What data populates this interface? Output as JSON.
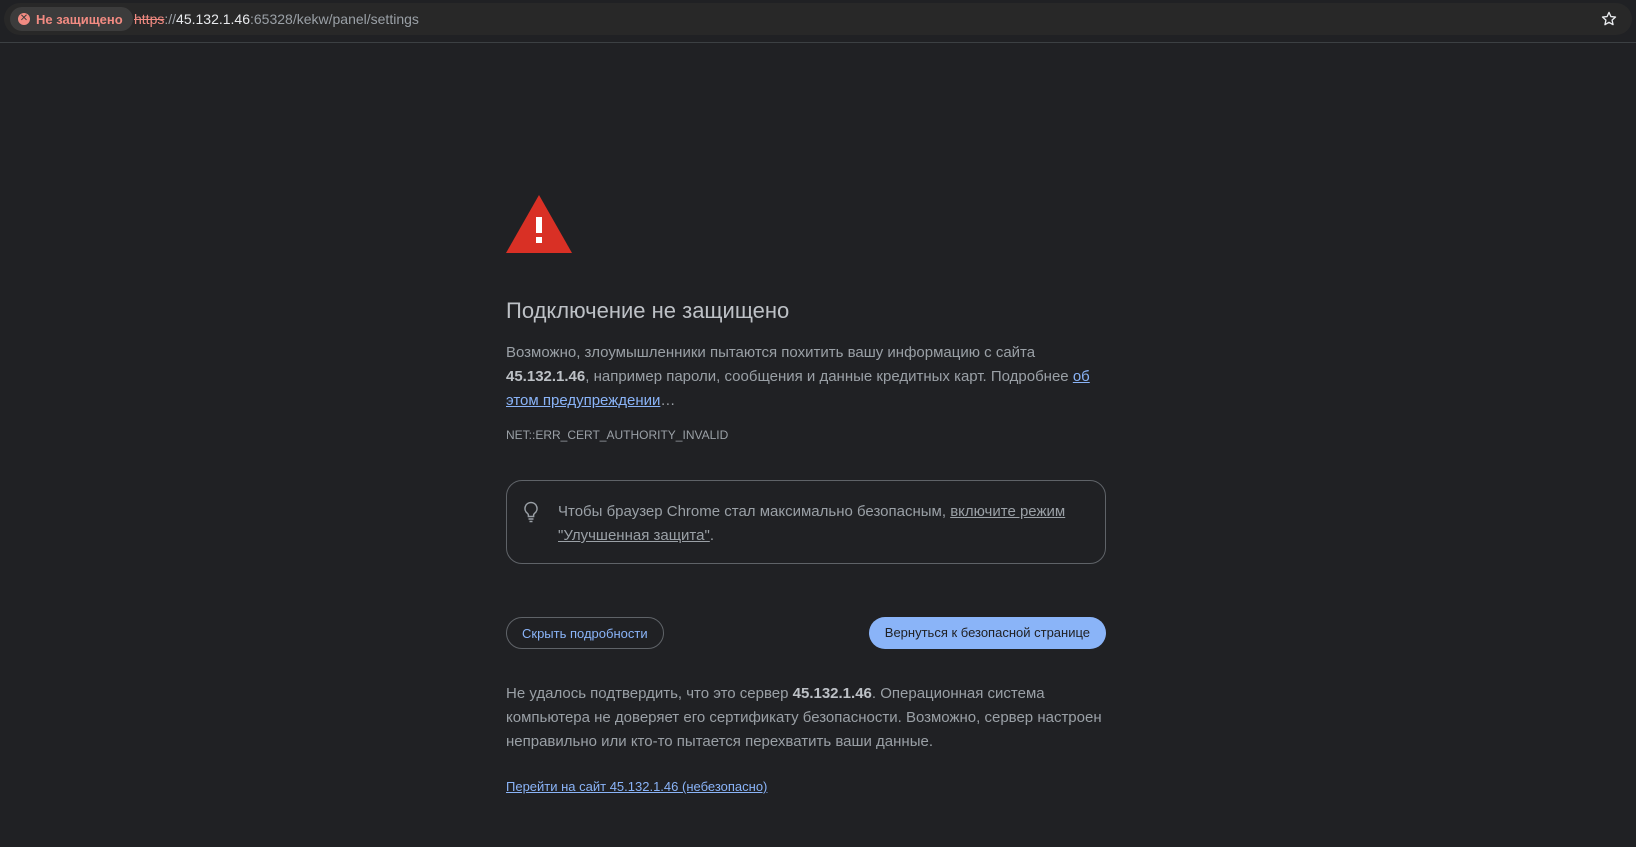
{
  "omnibox": {
    "security_chip_label": "Не защищено",
    "url_scheme": "https",
    "url_separator": "://",
    "url_host": "45.132.1.46",
    "url_path": ":65328/kekw/panel/settings"
  },
  "interstitial": {
    "heading": "Подключение не защищено",
    "intro_part1": "Возможно, злоумышленники пытаются похитить вашу информацию с сайта ",
    "intro_host": "45.132.1.46",
    "intro_part2": ", например пароли, сообщения и данные кредитных карт. Подробнее ",
    "intro_link": "об этом предупреждении",
    "intro_ellipsis": "…",
    "error_code": "NET::ERR_CERT_AUTHORITY_INVALID",
    "safe_browsing_text": "Чтобы браузер Chrome стал максимально безопасным, ",
    "safe_browsing_link": "включите режим \"Улучшенная защита\"",
    "safe_browsing_end": ".",
    "hide_details_button": "Скрыть подробности",
    "back_to_safety_button": "Вернуться к безопасной странице",
    "details_part1": "Не удалось подтвердить, что это сервер ",
    "details_host": "45.132.1.46",
    "details_part2": ". Операционная система компьютера не доверяет его сертификату безопасности. Возможно, сервер настроен неправильно или кто-то пытается перехватить ваши данные.",
    "proceed_link": "Перейти на сайт 45.132.1.46 (небезопасно)"
  },
  "icons": {
    "security_chip": "error-x-icon",
    "bookmark": "star-icon",
    "warning": "warning-triangle-icon",
    "tip": "lightbulb-icon"
  },
  "colors": {
    "background": "#202124",
    "warning_red": "#d93025",
    "link_blue": "#8ab4f8",
    "insecure_red": "#f28b82"
  }
}
